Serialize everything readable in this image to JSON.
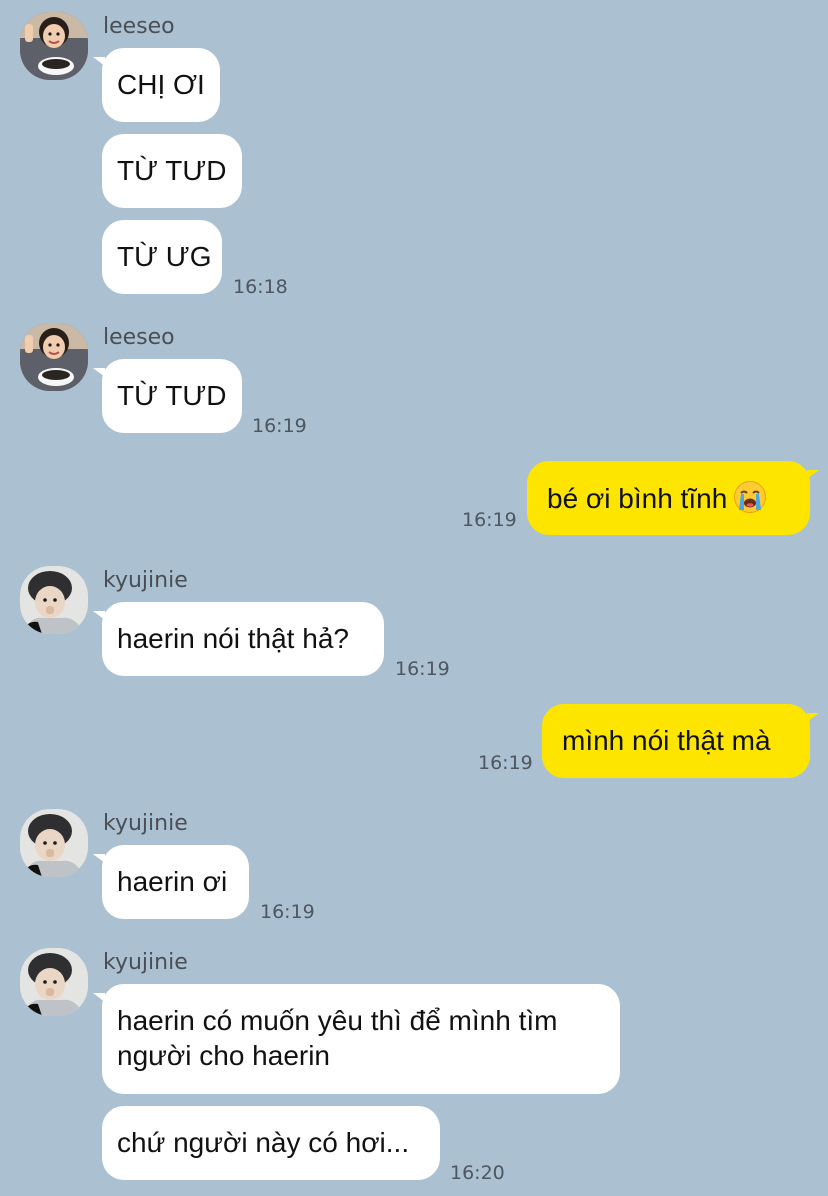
{
  "chat": {
    "colors": {
      "background": "#abc1d1",
      "incoming_bubble": "#ffffff",
      "outgoing_bubble": "#fee500"
    },
    "groups": [
      {
        "sender": "leeseo",
        "avatar": "leeseo-avatar",
        "messages": [
          "CHỊ ƠI",
          "TỪ TƯD",
          "TỪ ƯG"
        ],
        "time": "16:18"
      },
      {
        "sender": "leeseo",
        "avatar": "leeseo-avatar",
        "messages": [
          "TỪ TƯD"
        ],
        "time": "16:19"
      },
      {
        "sender": "me",
        "messages": [
          "bé ơi bình tĩnh"
        ],
        "emoji": "loudly-crying-face-icon",
        "time": "16:19"
      },
      {
        "sender": "kyujinie",
        "avatar": "kyujinie-avatar",
        "messages": [
          "haerin nói thật hả?"
        ],
        "time": "16:19"
      },
      {
        "sender": "me",
        "messages": [
          "mình nói thật mà"
        ],
        "time": "16:19"
      },
      {
        "sender": "kyujinie",
        "avatar": "kyujinie-avatar",
        "messages": [
          "haerin ơi"
        ],
        "time": "16:19"
      },
      {
        "sender": "kyujinie",
        "avatar": "kyujinie-avatar",
        "messages": [
          "haerin có muốn yêu thì để mình tìm người cho haerin",
          "chứ người này có hơi..."
        ],
        "time": "16:20"
      }
    ]
  }
}
